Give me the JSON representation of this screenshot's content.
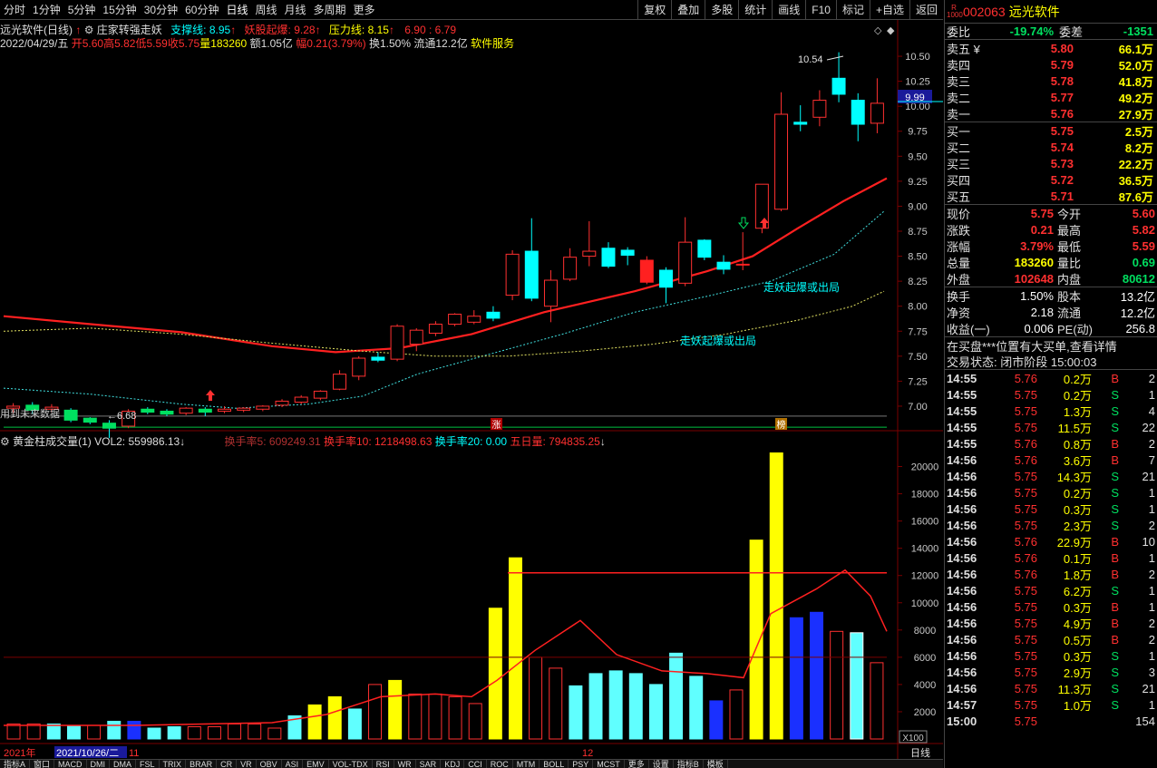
{
  "toolbar": {
    "periods": [
      "分时",
      "1分钟",
      "5分钟",
      "15分钟",
      "30分钟",
      "60分钟",
      "日线",
      "周线",
      "月线",
      "多周期",
      "更多"
    ],
    "buttons": [
      "复权",
      "叠加",
      "多股",
      "统计",
      "画线",
      "F10",
      "标记",
      "+自选",
      "返回"
    ]
  },
  "chart_header": {
    "title": "远光软件(日线)",
    "indicator": "庄家转强走妖",
    "support": "支撑线: 8.95",
    "yao": "妖股起爆: 9.28",
    "pressure": "压力线: 8.15",
    "mini": "6.90 : 6.79",
    "date": "2022/04/29/五",
    "open": "开5.60",
    "high": "高5.82",
    "low": "低5.59",
    "close": "收5.75",
    "vol": "量183260",
    "amount": "额1.05亿",
    "amp": "幅0.21(3.79%)",
    "turnover": "换1.50%",
    "float": "流通12.2亿",
    "sector": "软件服务",
    "future_note": "用到未来数据"
  },
  "vol_header": {
    "name": "黄金柱成交量(1)",
    "vol2": "VOL2: 559986.13",
    "h5": "换手率5: 609249.31",
    "h10": "换手率10: 1218498.63",
    "h20": "换手率20: 0.00",
    "d5": "五日量: 794835.25"
  },
  "annotations": {
    "high_label": "10.54",
    "low_label": "6.68",
    "breakout1": "走妖起爆或出局",
    "breakout2": "走妖起爆或出局",
    "zhang": "涨",
    "bang": "榜",
    "current_price_tag": "9.99",
    "x100": "X100",
    "year": "2021年",
    "date_cursor": "2021/10/26/二",
    "m11": "11",
    "m12": "12",
    "period_bottom": "日线"
  },
  "chart_data": [
    {
      "type": "candlestick",
      "y_axis_ticks": [
        10.5,
        10.25,
        10.0,
        9.75,
        9.5,
        9.25,
        9.0,
        8.75,
        8.5,
        8.25,
        8.0,
        7.75,
        7.5,
        7.25,
        7.0
      ],
      "ylim": [
        6.8,
        10.7
      ],
      "candles": [
        [
          6.98,
          7.0,
          6.93,
          7.03
        ],
        [
          7.01,
          6.96,
          6.92,
          7.04
        ],
        [
          6.97,
          6.99,
          6.94,
          7.02
        ],
        [
          6.96,
          6.86,
          6.84,
          6.98
        ],
        [
          6.88,
          6.84,
          6.82,
          6.89
        ],
        [
          6.83,
          6.78,
          6.68,
          6.86
        ],
        [
          6.8,
          6.95,
          6.78,
          6.97
        ],
        [
          6.97,
          6.94,
          6.92,
          6.99
        ],
        [
          6.95,
          6.92,
          6.9,
          6.97
        ],
        [
          6.93,
          6.98,
          6.91,
          6.99
        ],
        [
          6.97,
          6.94,
          6.9,
          6.99
        ],
        [
          6.95,
          6.97,
          6.93,
          7.0
        ],
        [
          6.96,
          6.98,
          6.94,
          6.99
        ],
        [
          6.97,
          7.0,
          6.95,
          7.01
        ],
        [
          7.01,
          7.05,
          6.99,
          7.07
        ],
        [
          7.04,
          7.09,
          7.02,
          7.11
        ],
        [
          7.08,
          7.15,
          7.06,
          7.16
        ],
        [
          7.17,
          7.32,
          7.16,
          7.36
        ],
        [
          7.3,
          7.48,
          7.26,
          7.5
        ],
        [
          7.49,
          7.46,
          7.44,
          7.54
        ],
        [
          7.47,
          7.8,
          7.45,
          7.82
        ],
        [
          7.62,
          7.76,
          7.55,
          7.78
        ],
        [
          7.73,
          7.82,
          7.7,
          7.85
        ],
        [
          7.82,
          7.92,
          7.8,
          7.93
        ],
        [
          7.84,
          7.9,
          7.82,
          7.96
        ],
        [
          7.94,
          7.88,
          7.85,
          8.0
        ],
        [
          8.11,
          8.52,
          8.06,
          8.56
        ],
        [
          8.55,
          8.08,
          8.05,
          8.88
        ],
        [
          8.0,
          8.26,
          7.84,
          8.36
        ],
        [
          8.27,
          8.49,
          8.25,
          8.58
        ],
        [
          8.5,
          8.55,
          8.4,
          8.85
        ],
        [
          8.58,
          8.4,
          8.38,
          8.64
        ],
        [
          8.56,
          8.51,
          8.41,
          8.59
        ],
        [
          8.46,
          8.24,
          8.22,
          8.5
        ],
        [
          8.36,
          8.19,
          8.03,
          8.39
        ],
        [
          8.23,
          8.64,
          8.2,
          8.89
        ],
        [
          8.66,
          8.49,
          8.46,
          8.67
        ],
        [
          8.44,
          8.37,
          8.32,
          8.51
        ],
        [
          8.42,
          8.42,
          8.36,
          8.74
        ],
        [
          8.78,
          9.22,
          8.73,
          9.22
        ],
        [
          8.97,
          9.92,
          8.95,
          10.14
        ],
        [
          9.84,
          9.82,
          9.75,
          10.01
        ],
        [
          9.89,
          10.06,
          9.8,
          10.16
        ],
        [
          10.28,
          10.12,
          10.04,
          10.54
        ],
        [
          10.06,
          9.82,
          9.65,
          10.13
        ],
        [
          9.83,
          10.03,
          9.73,
          10.28
        ]
      ],
      "ma_red_end": 9.28,
      "lines": [
        "red_ma",
        "cyan_dash",
        "yellow_dash",
        "green_flat"
      ]
    },
    {
      "type": "bar",
      "title": "黄金柱成交量(1)",
      "y_axis_ticks": [
        20000,
        18000,
        16000,
        14000,
        12000,
        10000,
        8000,
        6000,
        4000,
        2000
      ],
      "ylim": [
        0,
        21500
      ],
      "values": [
        1100,
        1100,
        1100,
        1000,
        1000,
        1300,
        1300,
        800,
        900,
        900,
        900,
        1100,
        1100,
        800,
        1700,
        2500,
        3100,
        2200,
        4000,
        4300,
        3300,
        3300,
        3100,
        2600,
        9600,
        13300,
        6000,
        5200,
        3900,
        4800,
        5000,
        4800,
        4000,
        6300,
        4600,
        2800,
        3600,
        14600,
        21000,
        8900,
        9300,
        7900,
        7800,
        5600
      ],
      "avg_line_value": 12200,
      "avg_line_value2": 6000
    }
  ],
  "side": {
    "badge": "R\n1000",
    "code": "002063",
    "name": "远光软件",
    "wb_label": "委比",
    "wb_val": "-19.74%",
    "wc_label": "委差",
    "wc_val": "-1351",
    "asks": [
      {
        "l": "卖五 ¥",
        "p": "5.80",
        "v": "66.1万"
      },
      {
        "l": "卖四",
        "p": "5.79",
        "v": "52.0万"
      },
      {
        "l": "卖三",
        "p": "5.78",
        "v": "41.8万"
      },
      {
        "l": "卖二",
        "p": "5.77",
        "v": "49.2万"
      },
      {
        "l": "卖一",
        "p": "5.76",
        "v": "27.9万"
      }
    ],
    "bids": [
      {
        "l": "买一",
        "p": "5.75",
        "v": "2.5万"
      },
      {
        "l": "买二",
        "p": "5.74",
        "v": "8.2万"
      },
      {
        "l": "买三",
        "p": "5.73",
        "v": "22.2万"
      },
      {
        "l": "买四",
        "p": "5.72",
        "v": "36.5万"
      },
      {
        "l": "买五",
        "p": "5.71",
        "v": "87.6万"
      }
    ],
    "quote": [
      {
        "l1": "现价",
        "v1": "5.75",
        "c1": "red",
        "l2": "今开",
        "v2": "5.60",
        "c2": "red"
      },
      {
        "l1": "涨跌",
        "v1": "0.21",
        "c1": "red",
        "l2": "最高",
        "v2": "5.82",
        "c2": "red"
      },
      {
        "l1": "涨幅",
        "v1": "3.79%",
        "c1": "red",
        "l2": "最低",
        "v2": "5.59",
        "c2": "red"
      },
      {
        "l1": "总量",
        "v1": "183260",
        "c1": "yellow",
        "l2": "量比",
        "v2": "0.69",
        "c2": "green"
      },
      {
        "l1": "外盘",
        "v1": "102648",
        "c1": "red",
        "l2": "内盘",
        "v2": "80612",
        "c2": "green"
      }
    ],
    "fund": [
      {
        "l1": "换手",
        "v1": "1.50%",
        "l2": "股本",
        "v2": "13.2亿"
      },
      {
        "l1": "净资",
        "v1": "2.18",
        "l2": "流通",
        "v2": "12.2亿"
      },
      {
        "l1": "收益(一)",
        "v1": "0.006",
        "l2": "PE(动)",
        "v2": "256.8"
      }
    ],
    "notice": "在买盘***位置有大买单,查看详情",
    "status": "交易状态: 闭市阶段 15:00:03",
    "ticks": [
      {
        "t": "14:55",
        "p": "5.76",
        "v": "0.2万",
        "bs": "B",
        "n": "2"
      },
      {
        "t": "14:55",
        "p": "5.75",
        "v": "0.2万",
        "bs": "S",
        "n": "1"
      },
      {
        "t": "14:55",
        "p": "5.75",
        "v": "1.3万",
        "bs": "S",
        "n": "4"
      },
      {
        "t": "14:55",
        "p": "5.75",
        "v": "11.5万",
        "bs": "S",
        "n": "22"
      },
      {
        "t": "14:55",
        "p": "5.76",
        "v": "0.8万",
        "bs": "B",
        "n": "2"
      },
      {
        "t": "14:56",
        "p": "5.76",
        "v": "3.6万",
        "bs": "B",
        "n": "7"
      },
      {
        "t": "14:56",
        "p": "5.75",
        "v": "14.3万",
        "bs": "S",
        "n": "21"
      },
      {
        "t": "14:56",
        "p": "5.75",
        "v": "0.2万",
        "bs": "S",
        "n": "1"
      },
      {
        "t": "14:56",
        "p": "5.75",
        "v": "0.3万",
        "bs": "S",
        "n": "1"
      },
      {
        "t": "14:56",
        "p": "5.75",
        "v": "2.3万",
        "bs": "S",
        "n": "2"
      },
      {
        "t": "14:56",
        "p": "5.76",
        "v": "22.9万",
        "bs": "B",
        "n": "10"
      },
      {
        "t": "14:56",
        "p": "5.76",
        "v": "0.1万",
        "bs": "B",
        "n": "1"
      },
      {
        "t": "14:56",
        "p": "5.76",
        "v": "1.8万",
        "bs": "B",
        "n": "2"
      },
      {
        "t": "14:56",
        "p": "5.75",
        "v": "6.2万",
        "bs": "S",
        "n": "1"
      },
      {
        "t": "14:56",
        "p": "5.75",
        "v": "0.3万",
        "bs": "B",
        "n": "1"
      },
      {
        "t": "14:56",
        "p": "5.75",
        "v": "4.9万",
        "bs": "B",
        "n": "2"
      },
      {
        "t": "14:56",
        "p": "5.75",
        "v": "0.5万",
        "bs": "B",
        "n": "2"
      },
      {
        "t": "14:56",
        "p": "5.75",
        "v": "0.3万",
        "bs": "S",
        "n": "1"
      },
      {
        "t": "14:56",
        "p": "5.75",
        "v": "2.9万",
        "bs": "S",
        "n": "3"
      },
      {
        "t": "14:56",
        "p": "5.75",
        "v": "11.3万",
        "bs": "S",
        "n": "21"
      },
      {
        "t": "14:57",
        "p": "5.75",
        "v": "1.0万",
        "bs": "S",
        "n": "1"
      },
      {
        "t": "15:00",
        "p": "5.75",
        "v": "",
        "bs": "",
        "n": "154"
      }
    ]
  },
  "bottom": [
    "指标A",
    "窗口",
    "MACD",
    "DMI",
    "DMA",
    "FSL",
    "TRIX",
    "BRAR",
    "CR",
    "VR",
    "OBV",
    "ASI",
    "EMV",
    "VOL-TDX",
    "RSI",
    "WR",
    "SAR",
    "KDJ",
    "CCI",
    "ROC",
    "MTM",
    "BOLL",
    "PSY",
    "MCST",
    "更多",
    "设置",
    "指标B",
    "模板"
  ],
  "colors": {
    "up": "#ff3030",
    "down": "#00ffff",
    "ma": "#ff2020",
    "grid": "#5a0000"
  }
}
